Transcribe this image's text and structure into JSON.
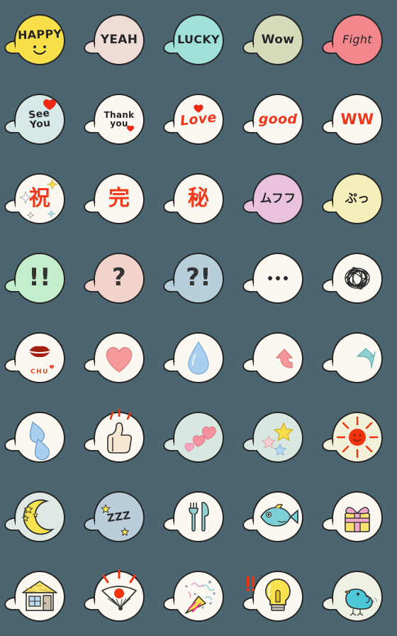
{
  "sheet": {
    "title": "Speech Bubble Emoji Sticker Sheet",
    "background_color": "#4b6670",
    "columns": 5,
    "rows": 8,
    "bubble_outline_color": "#262626"
  },
  "stickers": [
    {
      "id": 1,
      "row": 1,
      "col": 1,
      "name": "happy-bubble",
      "text": "HAPPY",
      "text_color": "#262626",
      "bubble_color": "#f7e04a",
      "extras": "smiley-face"
    },
    {
      "id": 2,
      "row": 1,
      "col": 2,
      "name": "yeah-bubble",
      "text": "YEAH",
      "text_color": "#262626",
      "bubble_color": "#f0dcd6",
      "extras": ""
    },
    {
      "id": 3,
      "row": 1,
      "col": 3,
      "name": "lucky-bubble",
      "text": "LUCKY",
      "text_color": "#262626",
      "bubble_color": "#9fe0d8",
      "extras": ""
    },
    {
      "id": 4,
      "row": 1,
      "col": 4,
      "name": "wow-bubble",
      "text": "Wow",
      "text_color": "#262626",
      "bubble_color": "#d5dcbc",
      "extras": ""
    },
    {
      "id": 5,
      "row": 1,
      "col": 5,
      "name": "fight-bubble",
      "text": "Fight",
      "text_color": "#262626",
      "bubble_color": "#f4878d",
      "extras": ""
    },
    {
      "id": 6,
      "row": 2,
      "col": 1,
      "name": "see-you-bubble",
      "text": "See\nYou",
      "text_color": "#262626",
      "bubble_color": "#d6e9e8",
      "extras": "red-heart-top-right"
    },
    {
      "id": 7,
      "row": 2,
      "col": 2,
      "name": "thank-you-bubble",
      "text": "Thank\nyou",
      "text_color": "#262626",
      "bubble_color": "#fbf8f2",
      "extras": "red-heart-inline"
    },
    {
      "id": 8,
      "row": 2,
      "col": 3,
      "name": "love-bubble",
      "text": "Love",
      "text_color": "#f0361c",
      "bubble_color": "#fbf8f2",
      "extras": "red-heart-above"
    },
    {
      "id": 9,
      "row": 2,
      "col": 4,
      "name": "good-bubble",
      "text": "good",
      "text_color": "#f0361c",
      "bubble_color": "#fbf8f2",
      "extras": ""
    },
    {
      "id": 10,
      "row": 2,
      "col": 5,
      "name": "ww-bubble",
      "text": "WW",
      "text_color": "#f0361c",
      "bubble_color": "#fbf8f2",
      "extras": ""
    },
    {
      "id": 11,
      "row": 3,
      "col": 1,
      "name": "iwai-kanji-bubble",
      "text": "祝",
      "text_color": "#f23a1c",
      "bubble_color": "#fbf8f2",
      "extras": "sparkles"
    },
    {
      "id": 12,
      "row": 3,
      "col": 2,
      "name": "kan-kanji-bubble",
      "text": "完",
      "text_color": "#f23a1c",
      "bubble_color": "#fbf8f2",
      "extras": ""
    },
    {
      "id": 13,
      "row": 3,
      "col": 3,
      "name": "himitsu-kanji-bubble",
      "text": "秘",
      "text_color": "#f23a1c",
      "bubble_color": "#fbf8f2",
      "extras": ""
    },
    {
      "id": 14,
      "row": 3,
      "col": 4,
      "name": "mufufu-bubble",
      "text": "ムフフ",
      "text_color": "#262626",
      "bubble_color": "#e9c3dd",
      "extras": ""
    },
    {
      "id": 15,
      "row": 3,
      "col": 5,
      "name": "putt-bubble",
      "text": "ぷっ",
      "text_color": "#262626",
      "bubble_color": "#f5efbb",
      "extras": ""
    },
    {
      "id": 16,
      "row": 4,
      "col": 1,
      "name": "double-exclamation-bubble",
      "text": "!!",
      "text_color": "#333333",
      "bubble_color": "#c4edcb",
      "extras": ""
    },
    {
      "id": 17,
      "row": 4,
      "col": 2,
      "name": "question-bubble",
      "text": "?",
      "text_color": "#333333",
      "bubble_color": "#f2d3cc",
      "extras": ""
    },
    {
      "id": 18,
      "row": 4,
      "col": 3,
      "name": "interrobang-bubble",
      "text": "?!",
      "text_color": "#333333",
      "bubble_color": "#b6cfdb",
      "extras": ""
    },
    {
      "id": 19,
      "row": 4,
      "col": 4,
      "name": "ellipsis-bubble",
      "text": "",
      "text_color": "#333333",
      "bubble_color": "#fbf8f2",
      "extras": "three-dots"
    },
    {
      "id": 20,
      "row": 4,
      "col": 5,
      "name": "scribble-bubble",
      "text": "",
      "text_color": "#333333",
      "bubble_color": "#fbf8f2",
      "extras": "scribble-ball"
    },
    {
      "id": 21,
      "row": 5,
      "col": 1,
      "name": "kiss-chu-bubble",
      "text": "CHU",
      "text_color": "#e2502e",
      "bubble_color": "#fbf8f2",
      "extras": "red-lips"
    },
    {
      "id": 22,
      "row": 5,
      "col": 2,
      "name": "pink-heart-bubble",
      "text": "",
      "text_color": "",
      "bubble_color": "#fbf8f2",
      "extras": "pink-heart"
    },
    {
      "id": 23,
      "row": 5,
      "col": 3,
      "name": "water-drop-bubble",
      "text": "",
      "text_color": "",
      "bubble_color": "#fbf8f2",
      "extras": "blue-droplet"
    },
    {
      "id": 24,
      "row": 5,
      "col": 4,
      "name": "up-arrow-bubble",
      "text": "",
      "text_color": "",
      "bubble_color": "#fbf8f2",
      "extras": "pink-up-arrow"
    },
    {
      "id": 25,
      "row": 5,
      "col": 5,
      "name": "down-arrow-bubble",
      "text": "",
      "text_color": "",
      "bubble_color": "#fbf8f2",
      "extras": "teal-down-arrow"
    },
    {
      "id": 26,
      "row": 6,
      "col": 1,
      "name": "tears-bubble",
      "text": "",
      "text_color": "",
      "bubble_color": "#fbf8f2",
      "extras": "two-blue-teardrops"
    },
    {
      "id": 27,
      "row": 6,
      "col": 2,
      "name": "thumbs-up-bubble",
      "text": "",
      "text_color": "",
      "bubble_color": "#fbf8f2",
      "extras": "thumbs-up-with-red-marks"
    },
    {
      "id": 28,
      "row": 6,
      "col": 3,
      "name": "three-hearts-bubble",
      "text": "",
      "text_color": "",
      "bubble_color": "#d8e8e0",
      "extras": "three-pink-hearts"
    },
    {
      "id": 29,
      "row": 6,
      "col": 4,
      "name": "stars-bubble",
      "text": "",
      "text_color": "",
      "bubble_color": "#d8e8e0",
      "extras": "yellow-pink-blue-stars"
    },
    {
      "id": 30,
      "row": 6,
      "col": 5,
      "name": "sun-bubble",
      "text": "",
      "text_color": "",
      "bubble_color": "#f2f0d8",
      "extras": "red-smiling-sun"
    },
    {
      "id": 31,
      "row": 7,
      "col": 1,
      "name": "moon-bubble",
      "text": "",
      "text_color": "",
      "bubble_color": "#dfe9e4",
      "extras": "yellow-crescent-moon-and-stars"
    },
    {
      "id": 32,
      "row": 7,
      "col": 2,
      "name": "sleeping-zzz-bubble",
      "text": "ZZZ",
      "text_color": "#2c2c2c",
      "bubble_color": "#b9cdda",
      "extras": "yellow-stars"
    },
    {
      "id": 33,
      "row": 7,
      "col": 3,
      "name": "cutlery-bubble",
      "text": "",
      "text_color": "",
      "bubble_color": "#fbf8f2",
      "extras": "fork-and-knife"
    },
    {
      "id": 34,
      "row": 7,
      "col": 4,
      "name": "fish-bubble",
      "text": "",
      "text_color": "",
      "bubble_color": "#fbf8f2",
      "extras": "blue-fish"
    },
    {
      "id": 35,
      "row": 7,
      "col": 5,
      "name": "gift-bubble",
      "text": "",
      "text_color": "",
      "bubble_color": "#fbf8f2",
      "extras": "yellow-gift-with-pink-ribbon"
    },
    {
      "id": 36,
      "row": 8,
      "col": 1,
      "name": "house-bubble",
      "text": "",
      "text_color": "",
      "bubble_color": "#fbf8f2",
      "extras": "house-yellow-roof"
    },
    {
      "id": 37,
      "row": 8,
      "col": 2,
      "name": "folding-fan-bubble",
      "text": "",
      "text_color": "",
      "bubble_color": "#fbf8f2",
      "extras": "fan-with-red-sun-and-rays"
    },
    {
      "id": 38,
      "row": 8,
      "col": 3,
      "name": "party-popper-bubble",
      "text": "",
      "text_color": "",
      "bubble_color": "#fbf8f2",
      "extras": "party-popper-confetti"
    },
    {
      "id": 39,
      "row": 8,
      "col": 4,
      "name": "light-bulb-bubble",
      "text": "",
      "text_color": "",
      "bubble_color": "#fbf8f2",
      "extras": "yellow-bulb-with-red-exclamations"
    },
    {
      "id": 40,
      "row": 8,
      "col": 5,
      "name": "bird-bubble",
      "text": "",
      "text_color": "",
      "bubble_color": "#eef2e4",
      "extras": "cyan-bird"
    }
  ]
}
